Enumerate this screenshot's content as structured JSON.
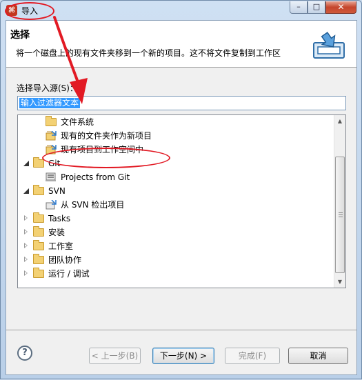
{
  "window": {
    "title": "导入",
    "close_glyph": "✕",
    "max_glyph": "□",
    "min_glyph": "–",
    "app_icon_glyph": "⌘"
  },
  "header": {
    "title": "选择",
    "description": "将一个磁盘上的现有文件夹移到一个新的项目。这不将文件复制到工作区",
    "icon": "import-tray-icon"
  },
  "source": {
    "label": "选择导入源(S)：",
    "filter_value": "输入过滤器文本"
  },
  "tree": {
    "items": [
      {
        "label": "文件系统",
        "icon": "folder-icon"
      },
      {
        "label": "现有的文件夹作为新项目",
        "icon": "project-icon"
      },
      {
        "label": "现有项目到工作空间中",
        "icon": "project-icon"
      },
      {
        "label": "Git",
        "icon": "folder-icon",
        "expanded": true
      },
      {
        "label": "Projects from Git",
        "icon": "git-repo-icon"
      },
      {
        "label": "SVN",
        "icon": "folder-icon",
        "expanded": true
      },
      {
        "label": "从 SVN 检出项目",
        "icon": "svn-checkout-icon"
      },
      {
        "label": "Tasks",
        "icon": "folder-icon",
        "expanded": false
      },
      {
        "label": "安装",
        "icon": "folder-icon",
        "expanded": false
      },
      {
        "label": "工作室",
        "icon": "folder-icon",
        "expanded": false
      },
      {
        "label": "团队协作",
        "icon": "folder-icon",
        "expanded": false
      },
      {
        "label": "运行 / 调试",
        "icon": "folder-icon",
        "expanded": false
      }
    ]
  },
  "buttons": {
    "help": "?",
    "back": "< 上一步(B)",
    "next": "下一步(N) >",
    "finish": "完成(F)",
    "cancel": "取消"
  },
  "colors": {
    "annotation_red": "#e21a24",
    "selection_blue": "#3399ff"
  }
}
